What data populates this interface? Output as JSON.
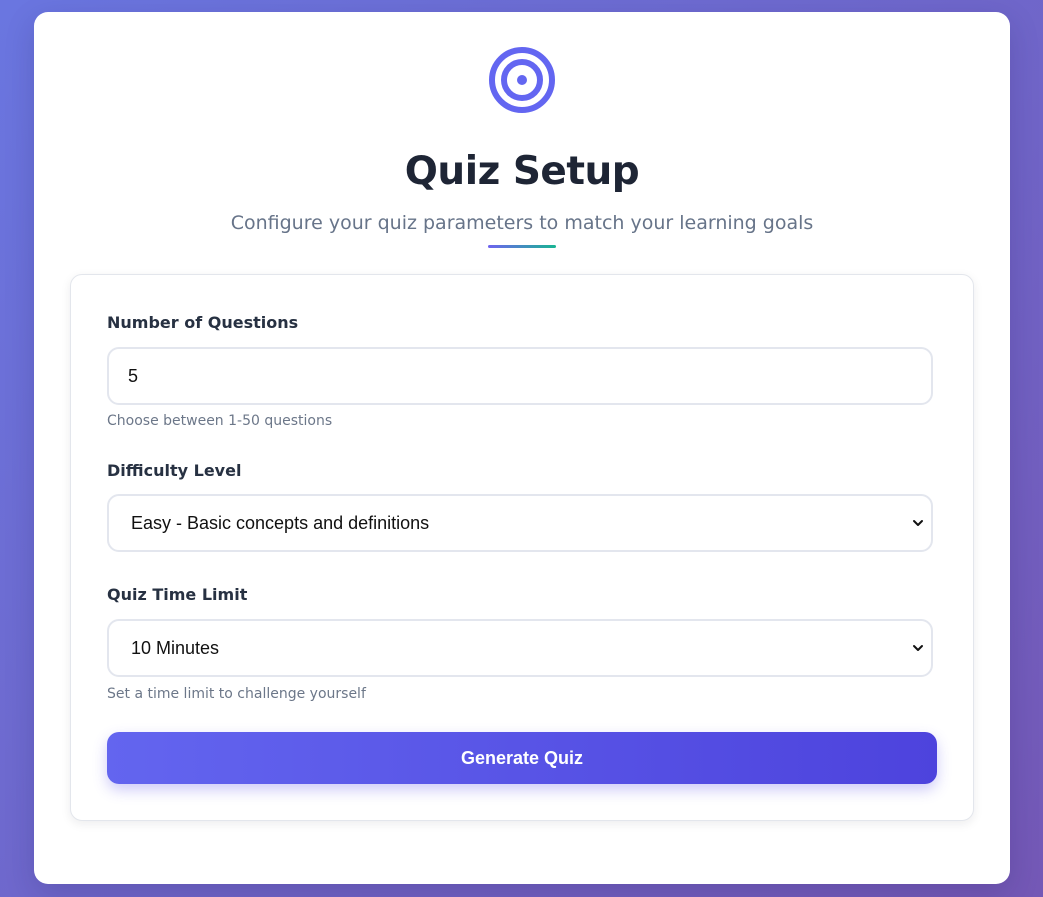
{
  "page": {
    "title": "Quiz Setup",
    "subtitle": "Configure your quiz parameters to match your learning goals",
    "icon": "target-icon",
    "accent_color": "#6366f1"
  },
  "form": {
    "num_questions": {
      "label": "Number of Questions",
      "value": "5",
      "hint": "Choose between 1-50 questions"
    },
    "difficulty": {
      "label": "Difficulty Level",
      "selected": "Easy - Basic concepts and definitions"
    },
    "time_limit": {
      "label": "Quiz Time Limit",
      "selected": "10 Minutes",
      "hint": "Set a time limit to challenge yourself"
    },
    "submit_label": "Generate Quiz"
  }
}
